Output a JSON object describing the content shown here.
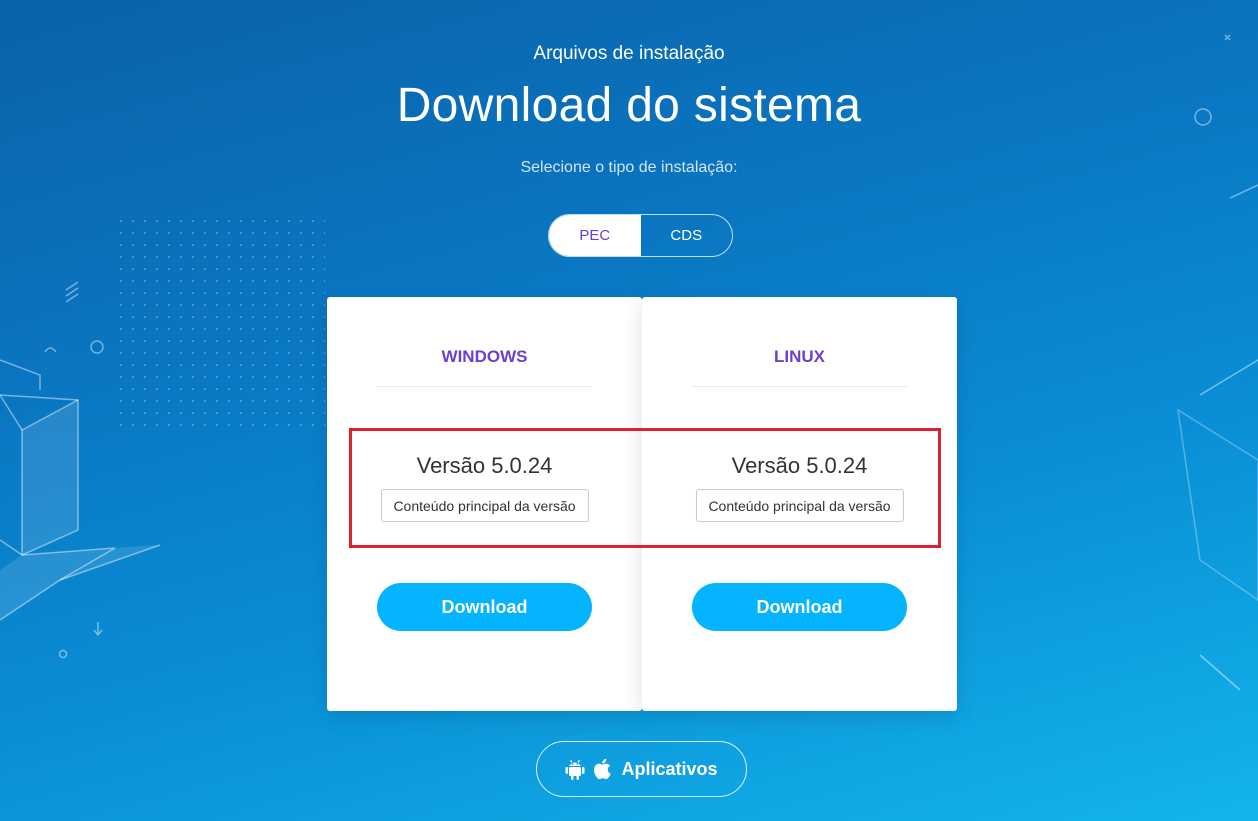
{
  "header": {
    "eyebrow": "Arquivos de instalação",
    "title": "Download do sistema",
    "subtitle": "Selecione o tipo de instalação:"
  },
  "install_type_toggle": {
    "options": [
      {
        "label": "PEC",
        "active": true
      },
      {
        "label": "CDS",
        "active": false
      }
    ]
  },
  "cards": [
    {
      "os": "WINDOWS",
      "version": "Versão 5.0.24",
      "notes_label": "Conteúdo principal da versão",
      "download_label": "Download"
    },
    {
      "os": "LINUX",
      "version": "Versão 5.0.24",
      "notes_label": "Conteúdo principal da versão",
      "download_label": "Download"
    }
  ],
  "apps_button": {
    "label": "Aplicativos",
    "icons": [
      "android-icon",
      "apple-icon"
    ]
  },
  "colors": {
    "accent_purple": "#6a3fd1",
    "download_blue": "#04b4ff",
    "highlight_red": "#e0202a"
  }
}
